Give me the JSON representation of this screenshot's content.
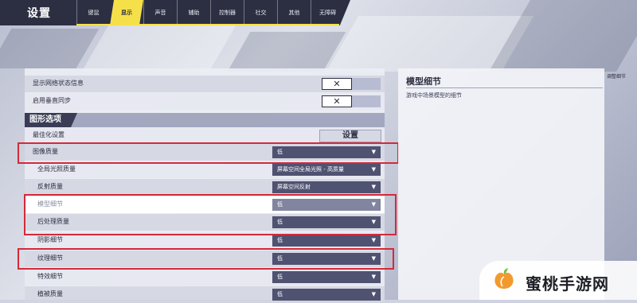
{
  "header": {
    "title": "设置",
    "tabs": [
      "键鼠",
      "显示",
      "声音",
      "辅助",
      "控制器",
      "社交",
      "其他",
      "无障碍"
    ],
    "active_tab": "显示"
  },
  "settings": {
    "net_status_label": "显示网络状态信息",
    "vsync_label": "启用垂直同步",
    "toggle_off_glyph": "✕",
    "section_title": "图形选项",
    "optimize_label": "最佳化设置",
    "optimize_button": "设置",
    "rows": [
      {
        "label": "图像质量",
        "value": "低"
      },
      {
        "label": "全局光照质量",
        "value": "屏幕空间全局光照 - 高质量"
      },
      {
        "label": "反射质量",
        "value": "屏幕空间反射"
      },
      {
        "label": "模型细节",
        "value": "低"
      },
      {
        "label": "后处理质量",
        "value": "低"
      },
      {
        "label": "阴影细节",
        "value": "低"
      },
      {
        "label": "纹理细节",
        "value": "低"
      },
      {
        "label": "特效细节",
        "value": "低"
      },
      {
        "label": "植被质量",
        "value": "低"
      }
    ],
    "caret": "▼"
  },
  "detail_panel": {
    "title": "模型细节",
    "description": "游戏中场景模型的细节"
  },
  "corner_tag": "调整细节",
  "watermark": {
    "text": "蜜桃手游网"
  },
  "colors": {
    "accent": "#f6e04a",
    "highlight_box": "#d32a3a",
    "dropdown": "#505271",
    "topbar": "#2c2f41"
  }
}
